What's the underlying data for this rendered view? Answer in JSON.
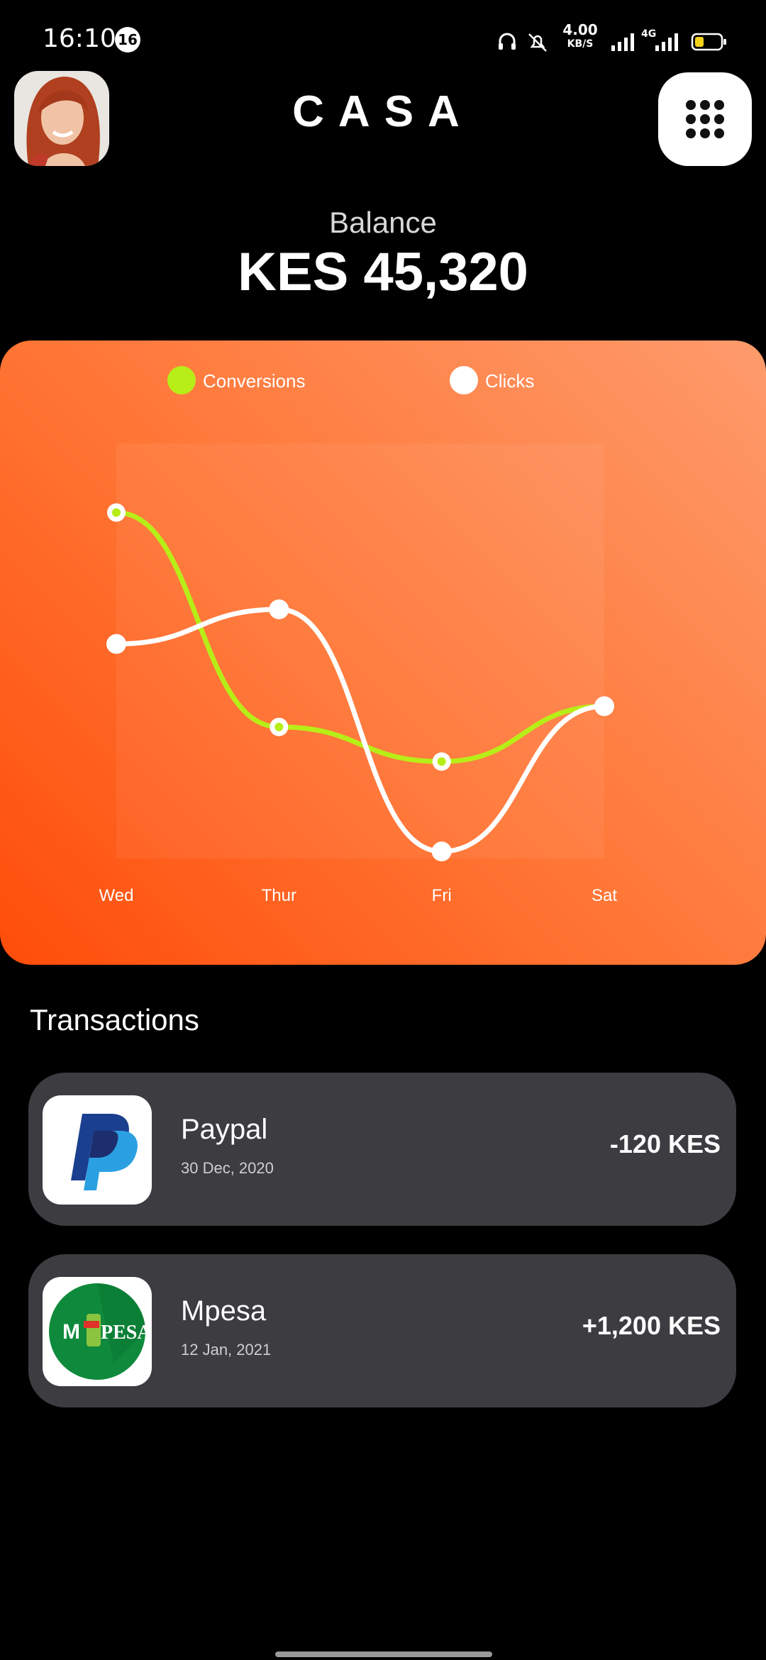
{
  "status_bar": {
    "time": "16:10",
    "notification_count": "16",
    "net_speed_value": "4.00",
    "net_speed_unit": "KB/S",
    "network_label": "4G"
  },
  "header": {
    "title": "CASA",
    "avatar_icon": "user-avatar",
    "menu_icon": "grid-dots-icon"
  },
  "balance": {
    "label": "Balance",
    "value": "KES 45,320"
  },
  "chart_data": {
    "type": "line",
    "categories": [
      "Wed",
      "Thur",
      "Fri",
      "Sat"
    ],
    "series": [
      {
        "name": "Conversions",
        "color": "#b7ee17",
        "values": [
          100,
          38,
          28,
          44
        ]
      },
      {
        "name": "Clicks",
        "color": "#ffffff",
        "values": [
          62,
          72,
          2,
          44
        ]
      }
    ],
    "ylim": [
      0,
      120
    ],
    "grid": false,
    "legend": "top-center",
    "title": "",
    "xlabel": "",
    "ylabel": ""
  },
  "transactions": {
    "title": "Transactions",
    "items": [
      {
        "name": "Paypal",
        "date": "30 Dec, 2020",
        "amount": "-120 KES",
        "icon": "paypal-logo"
      },
      {
        "name": "Mpesa",
        "date": "12 Jan, 2021",
        "amount": "+1,200 KES",
        "icon": "mpesa-logo",
        "logo_text_left": "M",
        "logo_text_right": "PESA"
      }
    ]
  }
}
